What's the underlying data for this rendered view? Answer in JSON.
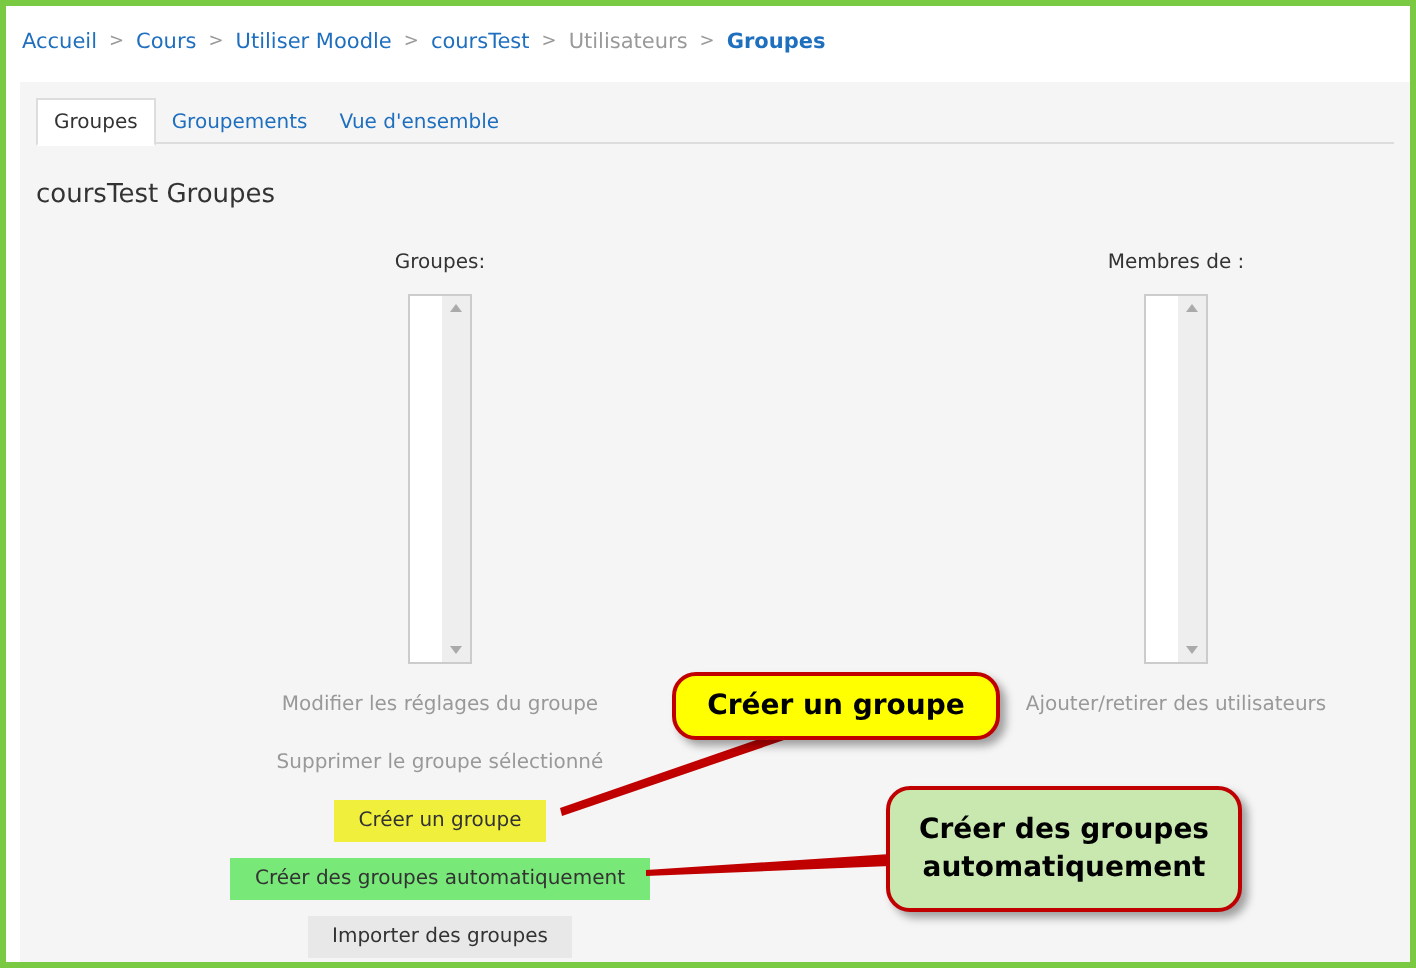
{
  "breadcrumb": [
    {
      "label": "Accueil",
      "link": true
    },
    {
      "label": "Cours",
      "link": true
    },
    {
      "label": "Utiliser Moodle",
      "link": true
    },
    {
      "label": "coursTest",
      "link": true
    },
    {
      "label": "Utilisateurs",
      "link": false
    },
    {
      "label": "Groupes",
      "link": true,
      "current": true
    }
  ],
  "breadcrumb_separator": ">",
  "tabs": [
    {
      "label": "Groupes",
      "selected": true
    },
    {
      "label": "Groupements",
      "selected": false
    },
    {
      "label": "Vue d'ensemble",
      "selected": false
    }
  ],
  "heading": "coursTest Groupes",
  "groups_column": {
    "label": "Groupes:",
    "buttons": [
      {
        "label": "Modifier les réglages du groupe",
        "disabled": true
      },
      {
        "label": "Supprimer le groupe sélectionné",
        "disabled": true
      },
      {
        "label": "Créer un groupe",
        "disabled": false,
        "color": "#f0f03c"
      },
      {
        "label": "Créer des groupes automatiquement",
        "disabled": false,
        "color": "#78e878"
      },
      {
        "label": "Importer des groupes",
        "disabled": false
      }
    ]
  },
  "members_column": {
    "label": "Membres de :",
    "buttons": [
      {
        "label": "Ajouter/retirer des utilisateurs",
        "disabled": true
      }
    ]
  },
  "callouts": [
    {
      "text": "Créer un groupe",
      "color": "#ffff00"
    },
    {
      "text": "Créer des groupes automatiquement",
      "color": "#c9e8b0"
    }
  ]
}
